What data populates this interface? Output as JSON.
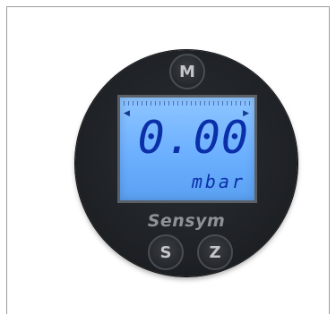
{
  "device": {
    "buttons": {
      "top": "M",
      "bottom_left": "S",
      "bottom_right": "Z"
    },
    "display": {
      "value": "0.00",
      "unit": "mbar"
    },
    "brand": "Sensym"
  }
}
